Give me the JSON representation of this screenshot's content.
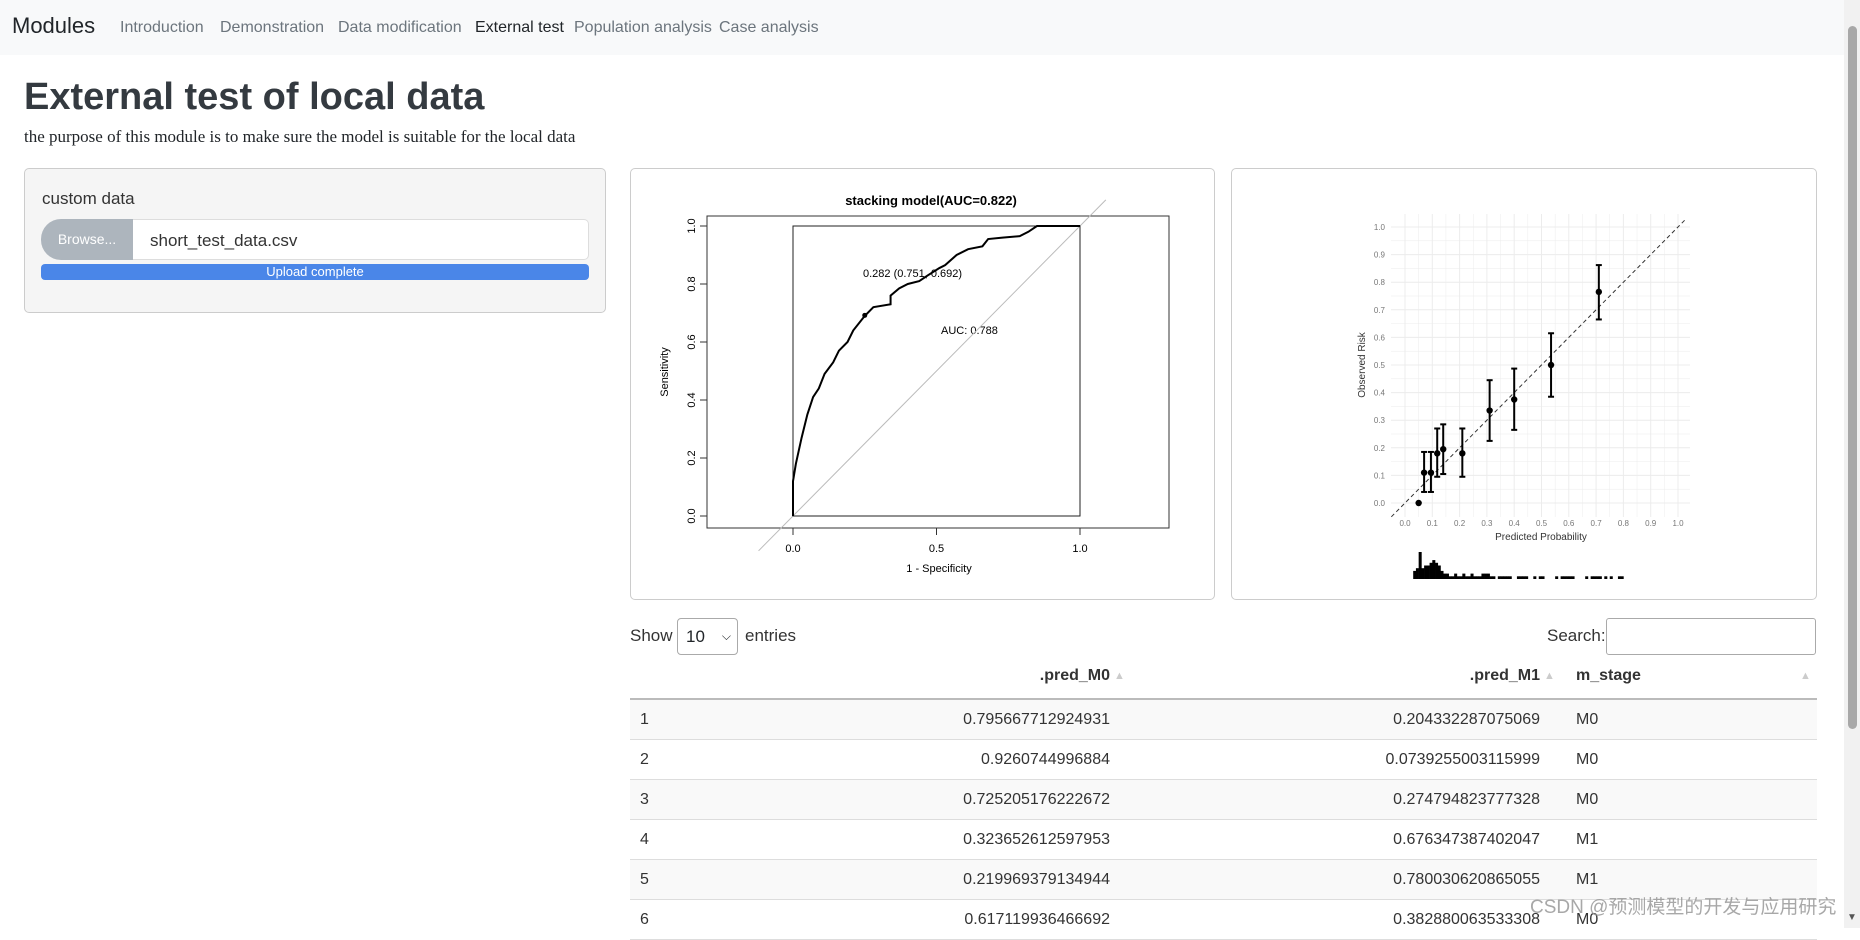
{
  "nav": {
    "brand": "Modules",
    "items": [
      {
        "label": "Introduction"
      },
      {
        "label": "Demonstration"
      },
      {
        "label": "Data modification"
      },
      {
        "label": "External test",
        "active": true
      },
      {
        "label": "Population analysis"
      },
      {
        "label": "Case analysis"
      }
    ]
  },
  "page": {
    "title": "External test of local data",
    "subtitle": "the purpose of this module is to make sure the model is suitable for the local data"
  },
  "upload": {
    "label": "custom data",
    "browse": "Browse...",
    "filename": "short_test_data.csv",
    "progress_text": "Upload complete",
    "progress": 100,
    "bar_color": "#4a86e8"
  },
  "chart_data": [
    {
      "type": "line",
      "title": "stacking model(AUC=0.822)",
      "xlabel": "1 - Specificity",
      "ylabel": "Sensitivity",
      "xlim": [
        0,
        1
      ],
      "ylim": [
        0,
        1
      ],
      "xticks": [
        "0.0",
        "0.5",
        "1.0"
      ],
      "yticks": [
        "0.0",
        "0.2",
        "0.4",
        "0.6",
        "0.8",
        "1.0"
      ],
      "annotations": [
        "0.282 (0.751, 0.692)",
        "AUC: 0.788"
      ],
      "threshold_point": [
        0.25,
        0.692
      ],
      "x": [
        0,
        0,
        0.01,
        0.03,
        0.05,
        0.07,
        0.09,
        0.11,
        0.14,
        0.16,
        0.19,
        0.21,
        0.25,
        0.28,
        0.34,
        0.34,
        0.37,
        0.4,
        0.44,
        0.47,
        0.51,
        0.53,
        0.57,
        0.61,
        0.66,
        0.68,
        0.73,
        0.79,
        0.82,
        0.85,
        1
      ],
      "y": [
        0,
        0.12,
        0.18,
        0.27,
        0.35,
        0.41,
        0.44,
        0.49,
        0.53,
        0.57,
        0.6,
        0.64,
        0.69,
        0.72,
        0.73,
        0.76,
        0.785,
        0.8,
        0.81,
        0.83,
        0.855,
        0.865,
        0.9,
        0.92,
        0.93,
        0.955,
        0.96,
        0.965,
        0.98,
        1,
        1
      ]
    },
    {
      "type": "scatter",
      "xlabel": "Predicted Probability",
      "ylabel": "Observed Risk",
      "xlim": [
        0,
        1
      ],
      "ylim": [
        0,
        1
      ],
      "grid": true,
      "ticks": [
        "0.0",
        "0.1",
        "0.2",
        "0.3",
        "0.4",
        "0.5",
        "0.6",
        "0.7",
        "0.8",
        "0.9",
        "1.0"
      ],
      "points": [
        {
          "x": 0.05,
          "y": 0
        },
        {
          "x": 0.07,
          "y": 0.11,
          "lo": 0.04,
          "hi": 0.185
        },
        {
          "x": 0.095,
          "y": 0.11,
          "lo": 0.04,
          "hi": 0.185
        },
        {
          "x": 0.118,
          "y": 0.18,
          "lo": 0.095,
          "hi": 0.27
        },
        {
          "x": 0.14,
          "y": 0.195,
          "lo": 0.105,
          "hi": 0.285
        },
        {
          "x": 0.21,
          "y": 0.18,
          "lo": 0.095,
          "hi": 0.27
        },
        {
          "x": 0.31,
          "y": 0.335,
          "lo": 0.225,
          "hi": 0.445
        },
        {
          "x": 0.4,
          "y": 0.375,
          "lo": 0.265,
          "hi": 0.487
        },
        {
          "x": 0.535,
          "y": 0.5,
          "lo": 0.385,
          "hi": 0.615
        },
        {
          "x": 0.71,
          "y": 0.765,
          "lo": 0.665,
          "hi": 0.862
        }
      ],
      "histogram": {
        "start": 0.03,
        "bin": 0.01,
        "counts": [
          3,
          4,
          10,
          4,
          5,
          5,
          6,
          7,
          6,
          5,
          3,
          2,
          2,
          1,
          1,
          2,
          1,
          1,
          2,
          1,
          1,
          2,
          1,
          1,
          1,
          2,
          2,
          2,
          1,
          1,
          0,
          1,
          1,
          1,
          1,
          1,
          0,
          0,
          1,
          1,
          1,
          1,
          0,
          0,
          1,
          0,
          1,
          1,
          0,
          0,
          0,
          0,
          1,
          0,
          1,
          1,
          1,
          1,
          1,
          0,
          0,
          0,
          0,
          1,
          0,
          1,
          1,
          1,
          1,
          0,
          1,
          0,
          1,
          0,
          0,
          1,
          1
        ]
      }
    }
  ],
  "table": {
    "show": "Show",
    "entries": "entries",
    "page_size": "10",
    "search_label": "Search:",
    "search_value": "",
    "columns": [
      "",
      ".pred_M0",
      ".pred_M1",
      "m_stage"
    ],
    "rows": [
      [
        "1",
        "0.795667712924931",
        "0.204332287075069",
        "M0"
      ],
      [
        "2",
        "0.9260744996884",
        "0.0739255003115999",
        "M0"
      ],
      [
        "3",
        "0.725205176222672",
        "0.274794823777328",
        "M0"
      ],
      [
        "4",
        "0.323652612597953",
        "0.676347387402047",
        "M1"
      ],
      [
        "5",
        "0.219969379134944",
        "0.780030620865055",
        "M1"
      ],
      [
        "6",
        "0.617119936466692",
        "0.382880063533308",
        "M0"
      ]
    ]
  },
  "watermark": "CSDN @预测模型的开发与应用研究"
}
